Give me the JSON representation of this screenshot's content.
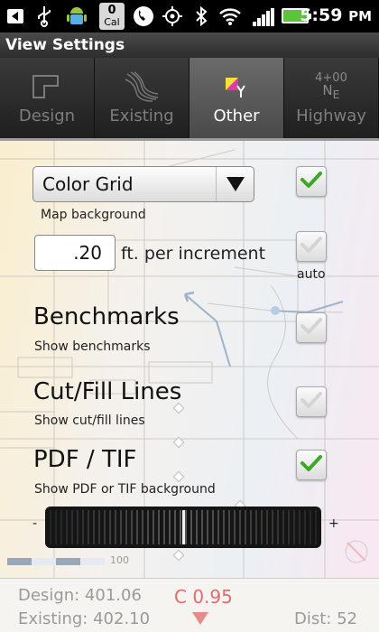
{
  "status_bar": {
    "icons": [
      "back-icon",
      "usb-icon",
      "android-icon",
      "calendar-icon",
      "phone-icon",
      "gps-icon",
      "bluetooth-icon",
      "wifi-icon",
      "signal-icon",
      "battery-icon"
    ],
    "calendar_count": "0",
    "calendar_label": "Cal",
    "time": "5:59",
    "time_suffix": "PM",
    "battery_color": "#5ac43a"
  },
  "title_bar": {
    "title": "View Settings"
  },
  "tabs": [
    {
      "label": "Design",
      "icon": "design-icon",
      "active": false
    },
    {
      "label": "Existing",
      "icon": "contour-lines-icon",
      "active": false
    },
    {
      "label": "Other",
      "icon": "color-swatch-icon",
      "active": true
    },
    {
      "label": "Highway",
      "icon": "station-icon",
      "active": false
    }
  ],
  "highway_icon_text": {
    "line1": "4+00",
    "line2": "N",
    "line3": "E"
  },
  "settings": {
    "map_background": {
      "selected": "Color Grid",
      "caption": "Map background",
      "checked": true
    },
    "increment": {
      "value": ".20",
      "unit_label": "ft. per increment",
      "auto_label": "auto",
      "auto_checked": false
    },
    "benchmarks": {
      "title": "Benchmarks",
      "caption": "Show benchmarks",
      "checked": false
    },
    "cut_fill": {
      "title": "Cut/Fill Lines",
      "caption": "Show cut/fill lines",
      "checked": false
    },
    "pdf_tif": {
      "title": "PDF / TIF",
      "caption": "Show PDF or TIF background",
      "checked": true,
      "opacity_min_label": "-",
      "opacity_max_label": "+",
      "opacity_value": 0.5
    }
  },
  "scale_bar": {
    "label": "100"
  },
  "bottom_bar": {
    "design": "Design: 401.06",
    "existing": "Existing: 402.10",
    "cut": "C 0.95",
    "dist": "Dist: 52"
  },
  "colors": {
    "check_green": "#3ea828",
    "cut_red": "#e46b6b",
    "active_tab_bg": "#5a5a5a"
  }
}
